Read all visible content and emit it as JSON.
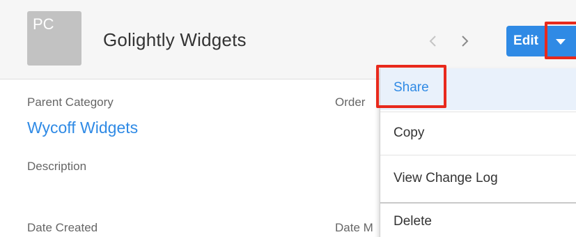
{
  "record": {
    "avatar_initials": "PC",
    "title": "Golightly Widgets"
  },
  "header": {
    "edit_label": "Edit"
  },
  "fields": {
    "parent_category_label": "Parent Category",
    "parent_category_value": "Wycoff Widgets",
    "order_label": "Order",
    "description_label": "Description",
    "date_created_label": "Date Created",
    "date_modified_label": "Date M"
  },
  "actions_menu": {
    "items": [
      {
        "label": "Share",
        "state": "highlighted"
      },
      {
        "label": "Copy"
      },
      {
        "label": "View Change Log"
      },
      {
        "label": "Delete"
      }
    ]
  },
  "colors": {
    "accent": "#2f8ae5",
    "highlight_box": "#e8291c",
    "header_bg": "#f6f6f6",
    "avatar_bg": "#c2c2c2"
  }
}
